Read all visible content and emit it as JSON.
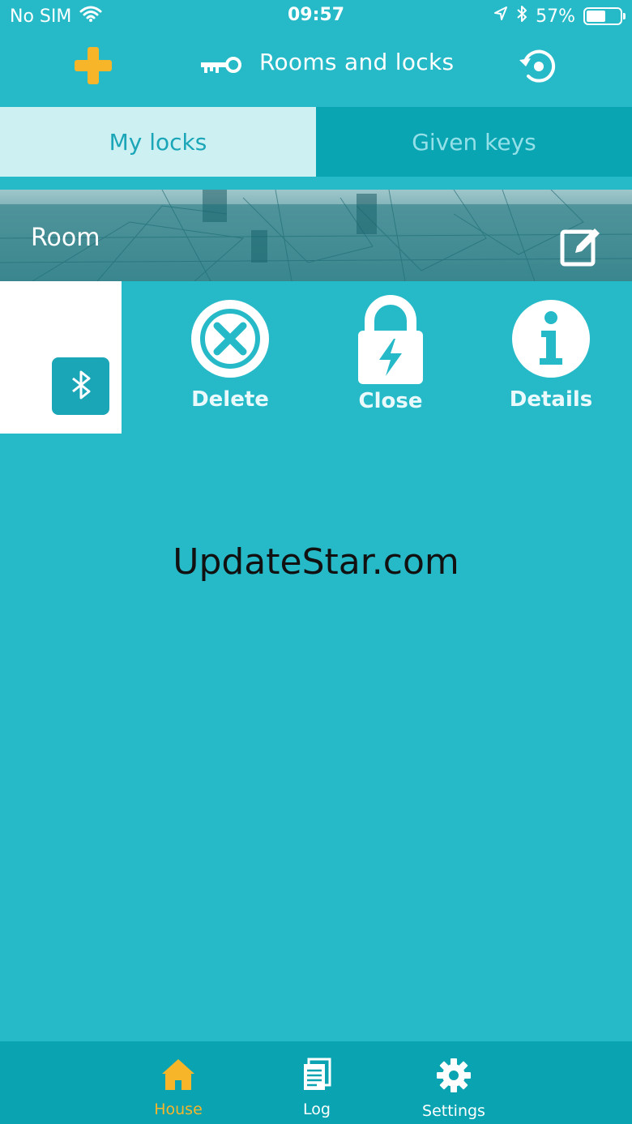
{
  "status_bar": {
    "carrier": "No SIM",
    "time": "09:57",
    "battery_percent": "57%",
    "battery_level": 0.57
  },
  "nav": {
    "title": "Rooms and locks",
    "add_icon": "plus-icon",
    "key_icon": "key-icon",
    "sync_icon": "sync-icon",
    "accent_color": "#f7b52a"
  },
  "tabs": [
    {
      "label": "My locks",
      "selected": true
    },
    {
      "label": "Given keys",
      "selected": false
    }
  ],
  "room": {
    "name": "Room",
    "edit_icon": "edit-icon"
  },
  "lock_row": {
    "bluetooth_icon": "bluetooth-icon",
    "actions": [
      {
        "label": "Delete",
        "icon": "close-circle-icon"
      },
      {
        "label": "Close",
        "icon": "lock-bolt-icon"
      },
      {
        "label": "Details",
        "icon": "info-icon"
      }
    ]
  },
  "watermark": "UpdateStar.com",
  "tab_bar": {
    "items": [
      {
        "label": "House",
        "icon": "house-icon",
        "active": true
      },
      {
        "label": "Log",
        "icon": "log-icon",
        "active": false
      },
      {
        "label": "Settings",
        "icon": "gear-icon",
        "active": false
      }
    ],
    "active_color": "#f7b52a"
  }
}
